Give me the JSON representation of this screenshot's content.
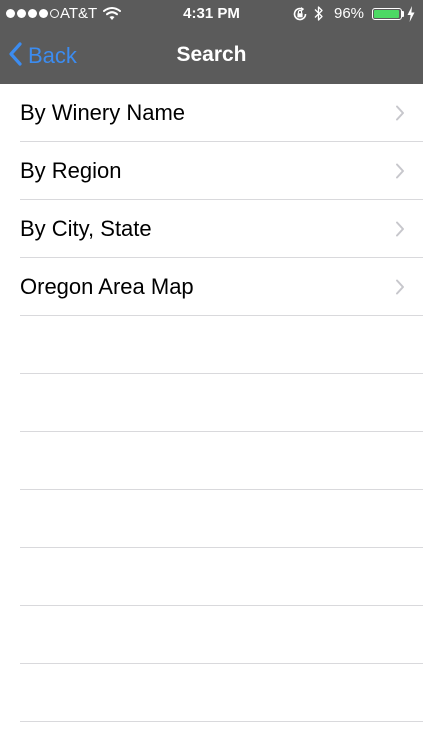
{
  "status_bar": {
    "carrier": "AT&T",
    "time": "4:31 PM",
    "battery_percent": "96%",
    "signal_bars_filled": 4,
    "signal_bars_total": 5,
    "battery_level": 0.96,
    "battery_color": "#4cd964",
    "icons": [
      "wifi-icon",
      "rotation-lock-icon",
      "bluetooth-icon",
      "battery-icon",
      "charging-icon"
    ]
  },
  "nav": {
    "back_label": "Back",
    "title": "Search",
    "back_icon": "chevron-left-icon",
    "bar_color": "#5b5b5b",
    "accent_color": "#3c8cf0"
  },
  "menu": {
    "items": [
      {
        "label": "By Winery Name",
        "icon": "chevron-right-icon"
      },
      {
        "label": "By Region",
        "icon": "chevron-right-icon"
      },
      {
        "label": "By City, State",
        "icon": "chevron-right-icon"
      },
      {
        "label": "Oregon Area Map",
        "icon": "chevron-right-icon"
      }
    ],
    "empty_rows": 7
  }
}
